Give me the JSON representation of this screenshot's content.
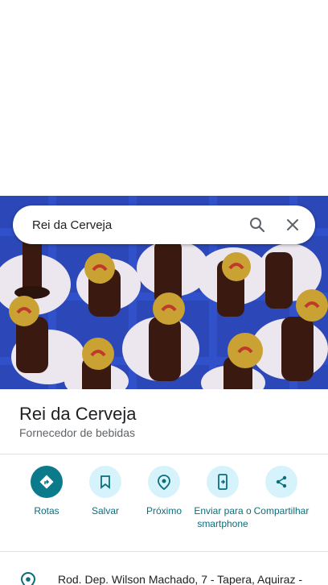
{
  "search": {
    "query": "Rei da Cerveja"
  },
  "place": {
    "title": "Rei da Cerveja",
    "category": "Fornecedor de bebidas"
  },
  "actions": [
    {
      "label": "Rotas",
      "icon": "directions-icon"
    },
    {
      "label": "Salvar",
      "icon": "bookmark-icon"
    },
    {
      "label": "Próximo",
      "icon": "nearby-icon"
    },
    {
      "label": "Enviar para o smartphone",
      "icon": "send-to-phone-icon"
    },
    {
      "label": "Compartilhar",
      "icon": "share-icon"
    }
  ],
  "address": {
    "text": "Rod. Dep. Wilson Machado, 7 - Tapera, Aquiraz -"
  },
  "colors": {
    "accent": "#0b7a8a",
    "accent_light": "#d6f3fb",
    "label": "#0b6e7b"
  }
}
